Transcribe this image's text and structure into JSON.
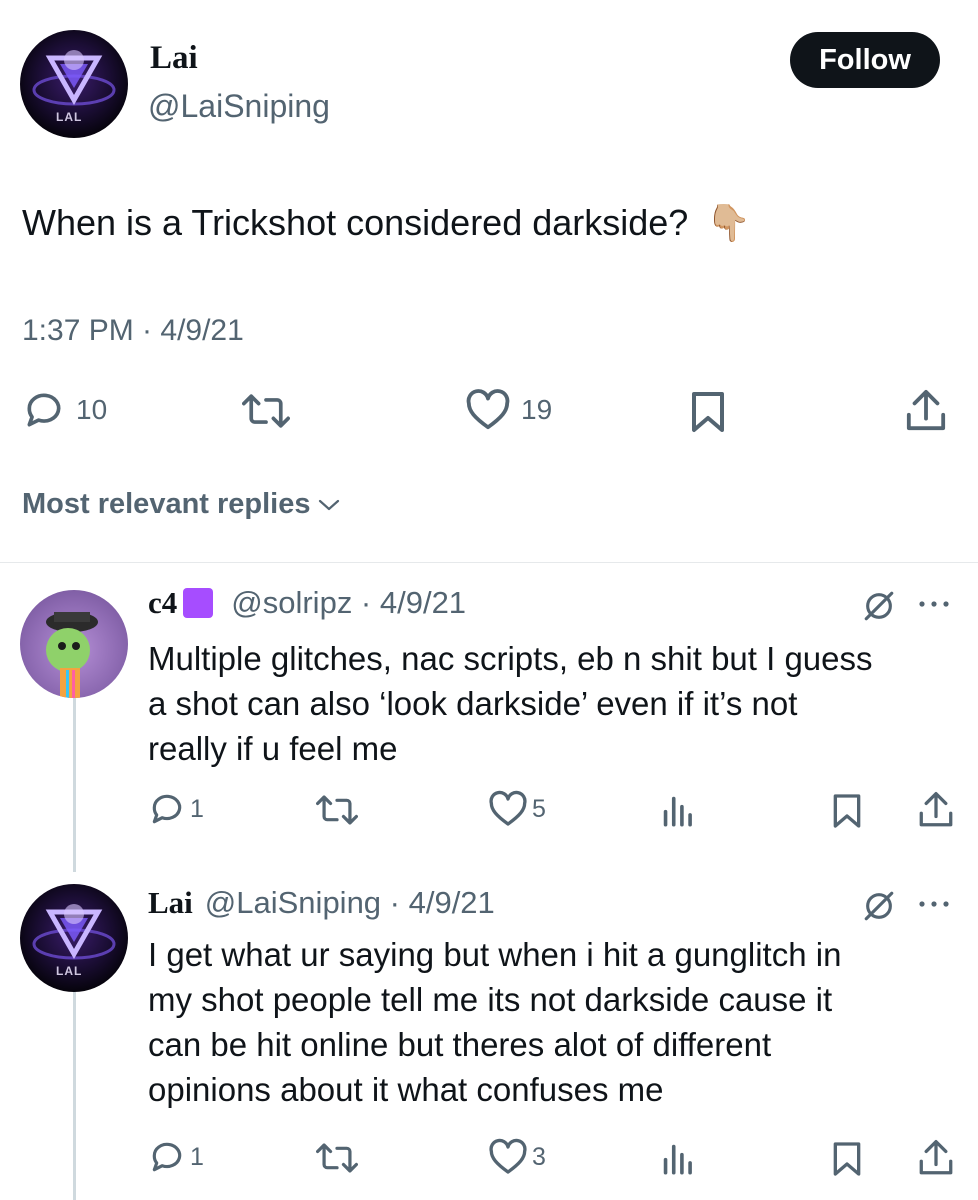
{
  "tweet": {
    "author_name": "Lai",
    "author_handle": "@LaiSniping",
    "avatar_letters": "LAL",
    "follow_label": "Follow",
    "text": "When is a Trickshot considered darkside?",
    "emoji": "👇🏼",
    "timestamp": "1:37 PM · 4/9/21",
    "stats": {
      "replies": "10",
      "likes": "19"
    }
  },
  "replies_header": {
    "label": "Most relevant replies"
  },
  "replies": [
    {
      "name": "c4",
      "badge_color": "#a64dff",
      "handle_date": "@solripz · 4/9/21",
      "lines": [
        "Multiple glitches, nac scripts, eb n shit but I guess",
        "a shot can also ‘look darkside’ even if it’s not",
        "really if u feel me"
      ],
      "replies": "1",
      "likes": "5"
    },
    {
      "name": "Lai",
      "handle_date": "@LaiSniping · 4/9/21",
      "lines": [
        "I get what ur saying but when i hit a gunglitch in",
        "my shot people tell me its not darkside cause it",
        "can be hit online but theres alot of different",
        "opinions about it what confuses me"
      ],
      "replies": "1",
      "likes": "3"
    }
  ],
  "icons": {
    "reply": "reply-icon",
    "retweet": "retweet-icon",
    "like": "heart-icon",
    "bookmark": "bookmark-icon",
    "share": "share-icon",
    "views": "views-icon",
    "grok": "grok-icon",
    "more": "more-icon"
  },
  "colors": {
    "text": "#0f1419",
    "secondary": "#536471",
    "follow_bg": "#0f1419",
    "divider": "#e6e9eb",
    "thread_line": "#cfd9de"
  }
}
